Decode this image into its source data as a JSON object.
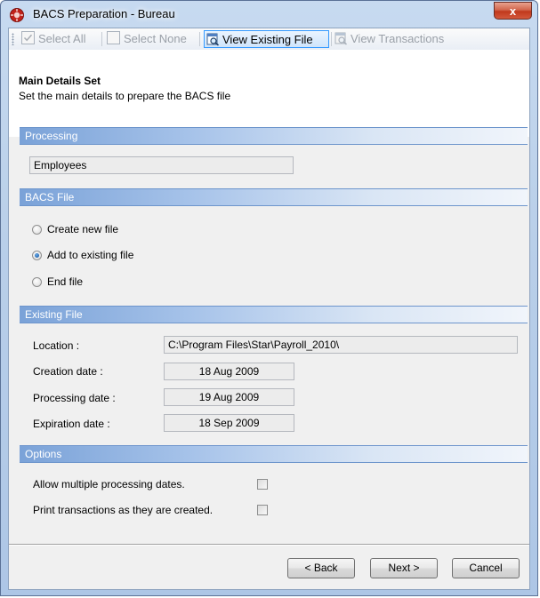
{
  "window": {
    "title": "BACS Preparation - Bureau",
    "close_glyph": "x"
  },
  "toolbar": {
    "select_all": "Select All",
    "select_none": "Select None",
    "view_existing_file": "View Existing File",
    "view_transactions": "View Transactions"
  },
  "header": {
    "title": "Main Details Set",
    "subtitle": "Set the main details to prepare the BACS file"
  },
  "processing": {
    "section_title": "Processing",
    "value": "Employees"
  },
  "bacs_file": {
    "section_title": "BACS File",
    "options": [
      {
        "label": "Create new file",
        "checked": false
      },
      {
        "label": "Add to existing file",
        "checked": true
      },
      {
        "label": "End file",
        "checked": false
      }
    ]
  },
  "existing_file": {
    "section_title": "Existing File",
    "location_label": "Location :",
    "location_value": "C:\\Program Files\\Star\\Payroll_2010\\",
    "creation_label": "Creation date :",
    "creation_value": "18 Aug 2009",
    "processing_label": "Processing date :",
    "processing_value": "19 Aug 2009",
    "expiration_label": "Expiration date :",
    "expiration_value": "18 Sep 2009"
  },
  "options": {
    "section_title": "Options",
    "allow_multiple": "Allow multiple processing dates.",
    "allow_multiple_checked": false,
    "print_transactions": "Print transactions as they are created.",
    "print_transactions_checked": false
  },
  "buttons": {
    "back": "< Back",
    "next": "Next >",
    "cancel": "Cancel"
  },
  "colors": {
    "section_header": "#7aa2d8",
    "close_button": "#c1391c",
    "active_toolbar_border": "#3399ff"
  }
}
